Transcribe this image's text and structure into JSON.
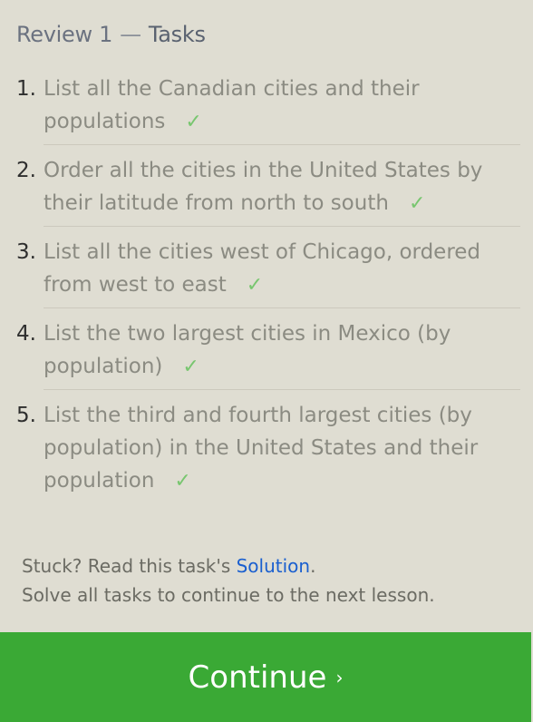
{
  "header": {
    "review": "Review 1",
    "dash": "—",
    "title": "Tasks"
  },
  "tasks": [
    {
      "number": "1.",
      "text": "List all the Canadian cities and their populations",
      "check": "✓"
    },
    {
      "number": "2.",
      "text": "Order all the cities in the United States by their latitude from north to south",
      "check": "✓"
    },
    {
      "number": "3.",
      "text": "List all the cities west of Chicago, ordered from west to east",
      "check": "✓"
    },
    {
      "number": "4.",
      "text": "List the two largest cities in Mexico (by population)",
      "check": "✓"
    },
    {
      "number": "5.",
      "text": "List the third and fourth largest cities (by population) in the United States and their population",
      "check": "✓"
    }
  ],
  "footer": {
    "stuck_prefix": "Stuck? Read this task's ",
    "solution_link": "Solution",
    "stuck_suffix": ".",
    "instruction": "Solve all tasks to continue to the next lesson."
  },
  "continue_button": {
    "label": "Continue",
    "arrow": "›"
  },
  "colors": {
    "background": "#dfddd2",
    "accent": "#3aa935",
    "check": "#78c66f",
    "link": "#1a5fcf"
  }
}
